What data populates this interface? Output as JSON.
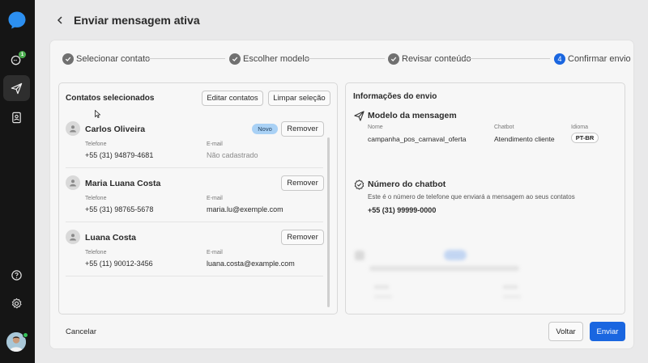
{
  "header": {
    "title": "Enviar mensagem ativa"
  },
  "sidebar": {
    "chat_badge": "1"
  },
  "steps": [
    {
      "number": "1",
      "label": "Selecionar contato",
      "status": "done"
    },
    {
      "number": "2",
      "label": "Escolher modelo",
      "status": "done"
    },
    {
      "number": "3",
      "label": "Revisar conteúdo",
      "status": "done"
    },
    {
      "number": "4",
      "label": "Confirmar envio",
      "status": "current"
    }
  ],
  "contacts_panel": {
    "title": "Contatos selecionados",
    "edit_label": "Editar contatos",
    "clear_label": "Limpar seleção",
    "remove_label": "Remover",
    "phone_label": "Telefone",
    "email_label": "E-mail",
    "contacts": [
      {
        "name": "Carlos Oliveira",
        "tag": "Novo",
        "phone": "+55 (31) 94879-4681",
        "email": "Não cadastrado"
      },
      {
        "name": "Maria Luana Costa",
        "phone": "+55 (31) 98765-5678",
        "email": "maria.lu@exemple.com"
      },
      {
        "name": "Luana Costa",
        "phone": "+55 (11) 90012-3456",
        "email": "luana.costa@example.com"
      }
    ]
  },
  "info_panel": {
    "title": "Informações do envio",
    "model_section": {
      "title": "Modelo da mensagem",
      "name_label": "Nome",
      "name_value": "campanha_pos_carnaval_oferta",
      "chatbot_label": "Chatbot",
      "chatbot_value": "Atendimento cliente",
      "language_label": "Idioma",
      "language_value": "PT-BR"
    },
    "chatbot_section": {
      "title": "Número do chatbot",
      "description": "Este é o número de telefone que enviará a mensagem ao seus contatos",
      "phone": "+55 (31) 99999-0000"
    }
  },
  "footer": {
    "cancel_label": "Cancelar",
    "back_label": "Voltar",
    "send_label": "Enviar"
  },
  "colors": {
    "accent": "#1a66e0",
    "sidebar": "#151515",
    "badge_new": "#a9d1f5",
    "online": "#35c35a"
  }
}
